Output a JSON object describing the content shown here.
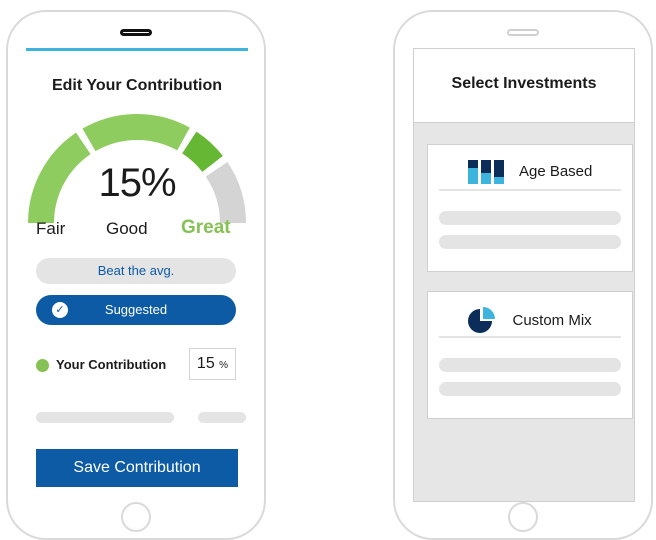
{
  "left_screen": {
    "title": "Edit Your Contribution",
    "gauge": {
      "percent": "15%",
      "value_fraction": 0.15,
      "labels": [
        "Fair",
        "Good",
        "Great"
      ],
      "colors": {
        "fair": "#8fcc5f",
        "good": "#8fcc5f",
        "great": "#66b834",
        "empty": "#d4d4d4"
      }
    },
    "beat_avg_label": "Beat the avg.",
    "suggested_label": "Suggested",
    "contribution": {
      "label": "Your Contribution",
      "value": "15",
      "unit": "%"
    },
    "save_label": "Save Contribution"
  },
  "right_screen": {
    "title": "Select Investments",
    "cards": [
      {
        "label": "Age Based",
        "icon": "bar-columns-icon"
      },
      {
        "label": "Custom Mix",
        "icon": "pie-chart-icon"
      }
    ]
  },
  "colors": {
    "accent_blue": "#0d5ba4",
    "top_bar": "#3cb4dd",
    "green": "#86c155",
    "grey": "#e4e4e4"
  }
}
